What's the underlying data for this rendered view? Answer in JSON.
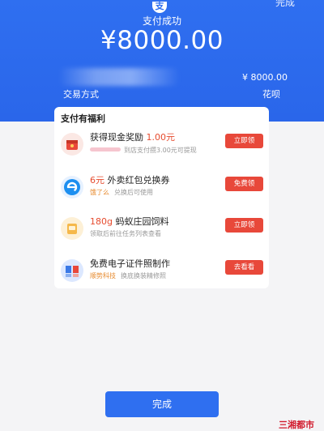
{
  "header": {
    "top_right": "完成",
    "logo": "支",
    "title": "支付成功",
    "amount": "¥8000.00",
    "right_amount": "¥ 8000.00",
    "method_label": "交易方式",
    "method_value": "花呗",
    "bg_color": "#2f6ff0"
  },
  "card": {
    "title": "支付有福利",
    "items": [
      {
        "title_prefix": "获得现金奖励",
        "title_highlight": "1.00元",
        "sub": "到店支付攒3.00元可提现",
        "button": "立即领"
      },
      {
        "title_highlight": "6元",
        "title_suffix": "外卖红包兑换券",
        "tag": "饿了么",
        "sub": "兑换后可使用",
        "button": "免费领"
      },
      {
        "title_highlight": "180g",
        "title_suffix": "蚂蚁庄园饲料",
        "sub": "领取后前往任务列表查看",
        "button": "立即领"
      },
      {
        "title_prefix": "免费电子证件照制作",
        "tag": "顺势科技",
        "sub": "换底换装精修照",
        "button": "去看看"
      }
    ]
  },
  "footer": {
    "done_button": "完成",
    "watermark": "三湘都市"
  }
}
